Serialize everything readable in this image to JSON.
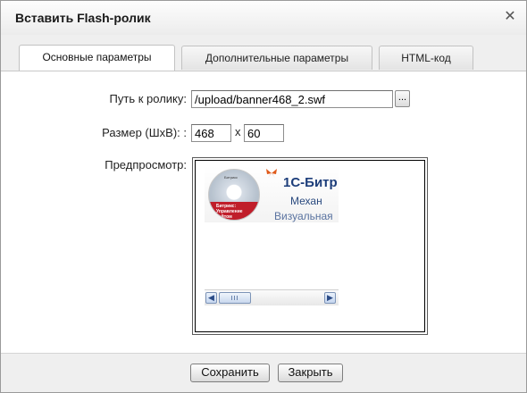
{
  "dialog": {
    "title": "Вставить Flash-ролик",
    "close_icon": "close-icon"
  },
  "tabs": [
    {
      "label": "Основные параметры",
      "active": true
    },
    {
      "label": "Дополнительные параметры",
      "active": false
    },
    {
      "label": "HTML-код",
      "active": false
    }
  ],
  "form": {
    "path_label": "Путь к ролику:",
    "path_value": "/upload/banner468_2.swf",
    "browse_label": "...",
    "size_label": "Размер (ШхВ): :",
    "width_value": "468",
    "times_sign": "x",
    "height_value": "60",
    "preview_label": "Предпросмотр:"
  },
  "preview": {
    "banner_title": "1С-Битр",
    "banner_subtitle": "Механ",
    "banner_subtitle2": "Визуальная",
    "cd_label": "Битрикс: Управление сайтом",
    "cd_logo": "Битрикс",
    "scroll_left_icon": "chevron-left-icon",
    "scroll_right_icon": "chevron-right-icon"
  },
  "footer": {
    "save_label": "Сохранить",
    "close_label": "Закрыть"
  }
}
